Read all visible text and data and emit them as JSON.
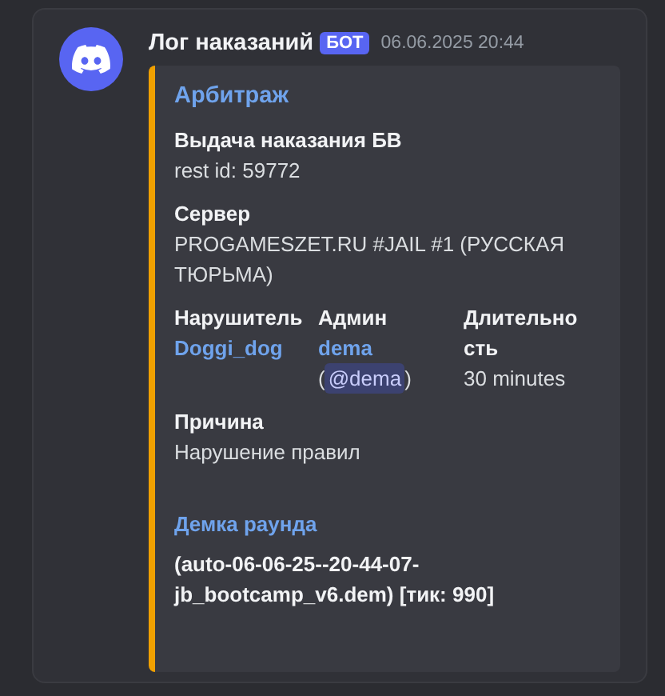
{
  "message": {
    "author": "Лог наказаний",
    "badge": "БОТ",
    "timestamp": "06.06.2025 20:44"
  },
  "embed": {
    "title": "Арбитраж",
    "fields": [
      {
        "name": "Выдача наказания БВ",
        "name_link": false,
        "inline": false,
        "values": [
          {
            "kind": "text",
            "text": "rest id: 59772"
          }
        ]
      },
      {
        "name": "Сервер",
        "name_link": false,
        "inline": false,
        "values": [
          {
            "kind": "text",
            "text": "PROGAMESZET.RU #JAIL #1 (РУССКАЯ ТЮРЬМА)"
          }
        ]
      },
      {
        "name": "Нарушитель",
        "name_link": false,
        "inline": true,
        "values": [
          {
            "kind": "link",
            "text": "Doggi_dog"
          }
        ]
      },
      {
        "name": "Админ",
        "name_link": false,
        "inline": true,
        "values": [
          {
            "kind": "link",
            "text": "dema"
          },
          {
            "kind": "mention",
            "before": "(",
            "text": "@dema",
            "after": ")"
          }
        ]
      },
      {
        "name": "Длительность",
        "name_link": false,
        "inline": true,
        "values": [
          {
            "kind": "text",
            "text": "30 minutes"
          }
        ]
      },
      {
        "name": "Причина",
        "name_link": false,
        "inline": false,
        "values": [
          {
            "kind": "text",
            "text": "Нарушение правил"
          }
        ]
      },
      {
        "name": "Демка раунда",
        "name_link": true,
        "inline": false,
        "values": [
          {
            "kind": "bold",
            "text": "(auto-06-06-25--20-44-07-jb_bootcamp_v6.dem) [тик: 990]"
          }
        ]
      }
    ]
  }
}
